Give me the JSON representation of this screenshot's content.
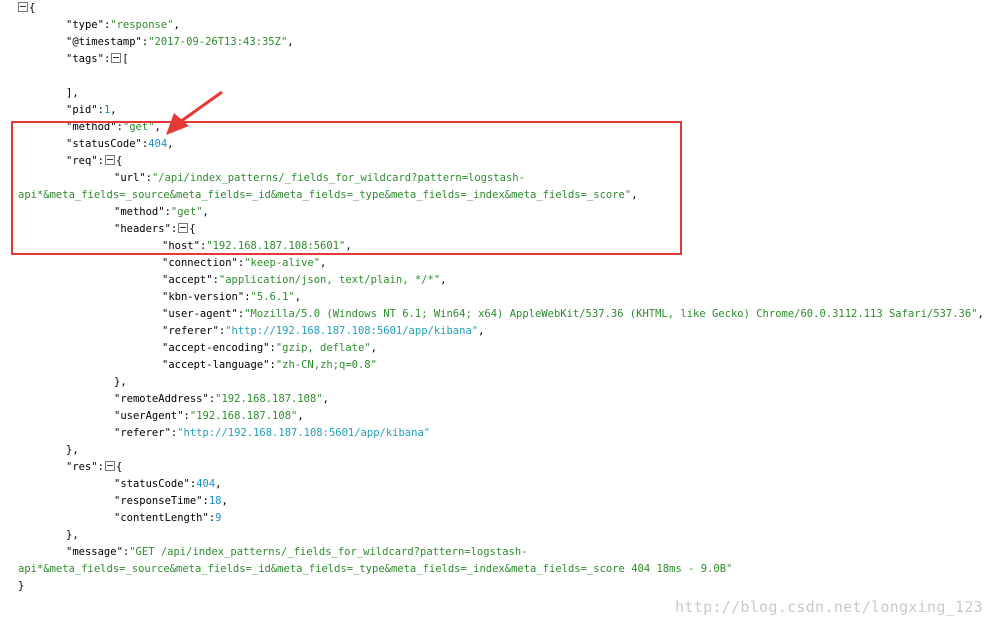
{
  "json_viewer": {
    "lines": [
      {
        "indent": 0,
        "toggle": true,
        "segs": [
          {
            "t": "{",
            "c": "p"
          }
        ]
      },
      {
        "indent": 1,
        "segs": [
          {
            "t": "\"type\"",
            "c": "k"
          },
          {
            "t": ":",
            "c": "p"
          },
          {
            "t": "\"response\"",
            "c": "s"
          },
          {
            "t": ",",
            "c": "p"
          }
        ]
      },
      {
        "indent": 1,
        "segs": [
          {
            "t": "\"@timestamp\"",
            "c": "k"
          },
          {
            "t": ":",
            "c": "p"
          },
          {
            "t": "\"2017-09-26T13:43:35Z\"",
            "c": "s"
          },
          {
            "t": ",",
            "c": "p"
          }
        ]
      },
      {
        "indent": 1,
        "segs": [
          {
            "t": "\"tags\"",
            "c": "k"
          },
          {
            "t": ":",
            "c": "p"
          }
        ],
        "toggle_after": true,
        "tail": "["
      },
      {
        "indent": 0,
        "segs": []
      },
      {
        "indent": 1,
        "segs": [
          {
            "t": "],",
            "c": "p"
          }
        ]
      },
      {
        "indent": 1,
        "segs": [
          {
            "t": "\"pid\"",
            "c": "k"
          },
          {
            "t": ":",
            "c": "p"
          },
          {
            "t": "1",
            "c": "n"
          },
          {
            "t": ",",
            "c": "p"
          }
        ]
      },
      {
        "indent": 1,
        "segs": [
          {
            "t": "\"method\"",
            "c": "k"
          },
          {
            "t": ":",
            "c": "p"
          },
          {
            "t": "\"get\"",
            "c": "s"
          },
          {
            "t": ",",
            "c": "p"
          }
        ]
      },
      {
        "indent": 1,
        "segs": [
          {
            "t": "\"statusCode\"",
            "c": "k"
          },
          {
            "t": ":",
            "c": "p"
          },
          {
            "t": "404",
            "c": "n"
          },
          {
            "t": ",",
            "c": "p"
          }
        ]
      },
      {
        "indent": 1,
        "segs": [
          {
            "t": "\"req\"",
            "c": "k"
          },
          {
            "t": ":",
            "c": "p"
          }
        ],
        "toggle_after": true,
        "tail": "{"
      },
      {
        "indent": 2,
        "segs": [
          {
            "t": "\"url\"",
            "c": "k"
          },
          {
            "t": ":",
            "c": "p"
          },
          {
            "t": "\"/api/index_patterns/_fields_for_wildcard?pattern=logstash-",
            "c": "s"
          }
        ]
      },
      {
        "indent": 0,
        "segs": [
          {
            "t": "api*&meta_fields=_source&meta_fields=_id&meta_fields=_type&meta_fields=_index&meta_fields=_score\"",
            "c": "s"
          },
          {
            "t": ",",
            "c": "p"
          }
        ]
      },
      {
        "indent": 2,
        "segs": [
          {
            "t": "\"method\"",
            "c": "k"
          },
          {
            "t": ":",
            "c": "p"
          },
          {
            "t": "\"get\"",
            "c": "s"
          },
          {
            "t": ",",
            "c": "p"
          }
        ]
      },
      {
        "indent": 2,
        "segs": [
          {
            "t": "\"headers\"",
            "c": "k"
          },
          {
            "t": ":",
            "c": "p"
          }
        ],
        "toggle_after": true,
        "tail": "{"
      },
      {
        "indent": 3,
        "segs": [
          {
            "t": "\"host\"",
            "c": "k"
          },
          {
            "t": ":",
            "c": "p"
          },
          {
            "t": "\"192.168.187.108:5601\"",
            "c": "s"
          },
          {
            "t": ",",
            "c": "p"
          }
        ]
      },
      {
        "indent": 3,
        "segs": [
          {
            "t": "\"connection\"",
            "c": "k"
          },
          {
            "t": ":",
            "c": "p"
          },
          {
            "t": "\"keep-alive\"",
            "c": "s"
          },
          {
            "t": ",",
            "c": "p"
          }
        ]
      },
      {
        "indent": 3,
        "segs": [
          {
            "t": "\"accept\"",
            "c": "k"
          },
          {
            "t": ":",
            "c": "p"
          },
          {
            "t": "\"application/json, text/plain, */*\"",
            "c": "s"
          },
          {
            "t": ",",
            "c": "p"
          }
        ]
      },
      {
        "indent": 3,
        "segs": [
          {
            "t": "\"kbn-version\"",
            "c": "k"
          },
          {
            "t": ":",
            "c": "p"
          },
          {
            "t": "\"5.6.1\"",
            "c": "s"
          },
          {
            "t": ",",
            "c": "p"
          }
        ]
      },
      {
        "indent": 3,
        "segs": [
          {
            "t": "\"user-agent\"",
            "c": "k"
          },
          {
            "t": ":",
            "c": "p"
          },
          {
            "t": "\"Mozilla/5.0 (Windows NT 6.1; Win64; x64) AppleWebKit/537.36 (KHTML, like Gecko) Chrome/60.0.3112.113 Safari/537.36\"",
            "c": "s"
          },
          {
            "t": ",",
            "c": "p"
          }
        ]
      },
      {
        "indent": 3,
        "segs": [
          {
            "t": "\"referer\"",
            "c": "k"
          },
          {
            "t": ":",
            "c": "p"
          },
          {
            "t": "\"http://192.168.187.108:5601/app/kibana\"",
            "c": "u"
          },
          {
            "t": ",",
            "c": "p"
          }
        ]
      },
      {
        "indent": 3,
        "segs": [
          {
            "t": "\"accept-encoding\"",
            "c": "k"
          },
          {
            "t": ":",
            "c": "p"
          },
          {
            "t": "\"gzip, deflate\"",
            "c": "s"
          },
          {
            "t": ",",
            "c": "p"
          }
        ]
      },
      {
        "indent": 3,
        "segs": [
          {
            "t": "\"accept-language\"",
            "c": "k"
          },
          {
            "t": ":",
            "c": "p"
          },
          {
            "t": "\"zh-CN,zh;q=0.8\"",
            "c": "s"
          }
        ]
      },
      {
        "indent": 2,
        "segs": [
          {
            "t": "},",
            "c": "p"
          }
        ]
      },
      {
        "indent": 2,
        "segs": [
          {
            "t": "\"remoteAddress\"",
            "c": "k"
          },
          {
            "t": ":",
            "c": "p"
          },
          {
            "t": "\"192.168.187.108\"",
            "c": "s"
          },
          {
            "t": ",",
            "c": "p"
          }
        ]
      },
      {
        "indent": 2,
        "segs": [
          {
            "t": "\"userAgent\"",
            "c": "k"
          },
          {
            "t": ":",
            "c": "p"
          },
          {
            "t": "\"192.168.187.108\"",
            "c": "s"
          },
          {
            "t": ",",
            "c": "p"
          }
        ]
      },
      {
        "indent": 2,
        "segs": [
          {
            "t": "\"referer\"",
            "c": "k"
          },
          {
            "t": ":",
            "c": "p"
          },
          {
            "t": "\"http://192.168.187.108:5601/app/kibana\"",
            "c": "u"
          }
        ]
      },
      {
        "indent": 1,
        "segs": [
          {
            "t": "},",
            "c": "p"
          }
        ]
      },
      {
        "indent": 1,
        "segs": [
          {
            "t": "\"res\"",
            "c": "k"
          },
          {
            "t": ":",
            "c": "p"
          }
        ],
        "toggle_after": true,
        "tail": "{"
      },
      {
        "indent": 2,
        "segs": [
          {
            "t": "\"statusCode\"",
            "c": "k"
          },
          {
            "t": ":",
            "c": "p"
          },
          {
            "t": "404",
            "c": "n"
          },
          {
            "t": ",",
            "c": "p"
          }
        ]
      },
      {
        "indent": 2,
        "segs": [
          {
            "t": "\"responseTime\"",
            "c": "k"
          },
          {
            "t": ":",
            "c": "p"
          },
          {
            "t": "18",
            "c": "n"
          },
          {
            "t": ",",
            "c": "p"
          }
        ]
      },
      {
        "indent": 2,
        "segs": [
          {
            "t": "\"contentLength\"",
            "c": "k"
          },
          {
            "t": ":",
            "c": "p"
          },
          {
            "t": "9",
            "c": "n"
          }
        ]
      },
      {
        "indent": 1,
        "segs": [
          {
            "t": "},",
            "c": "p"
          }
        ]
      },
      {
        "indent": 1,
        "segs": [
          {
            "t": "\"message\"",
            "c": "k"
          },
          {
            "t": ":",
            "c": "p"
          },
          {
            "t": "\"GET /api/index_patterns/_fields_for_wildcard?pattern=logstash-",
            "c": "s"
          }
        ]
      },
      {
        "indent": 0,
        "segs": [
          {
            "t": "api*&meta_fields=_source&meta_fields=_id&meta_fields=_type&meta_fields=_index&meta_fields=_score 404 18ms - 9.0B\"",
            "c": "s"
          }
        ]
      },
      {
        "indent": 0,
        "segs": [
          {
            "t": "}",
            "c": "p"
          }
        ]
      }
    ]
  },
  "annotation": {
    "box_color": "#e53935",
    "arrow_color": "#e53935"
  },
  "watermark": {
    "text": "http://blog.csdn.net/longxing_123"
  },
  "colors": {
    "key": "#000000",
    "string": "#2e8b2e",
    "number": "#1a8fbf",
    "url": "#20a0b8"
  }
}
